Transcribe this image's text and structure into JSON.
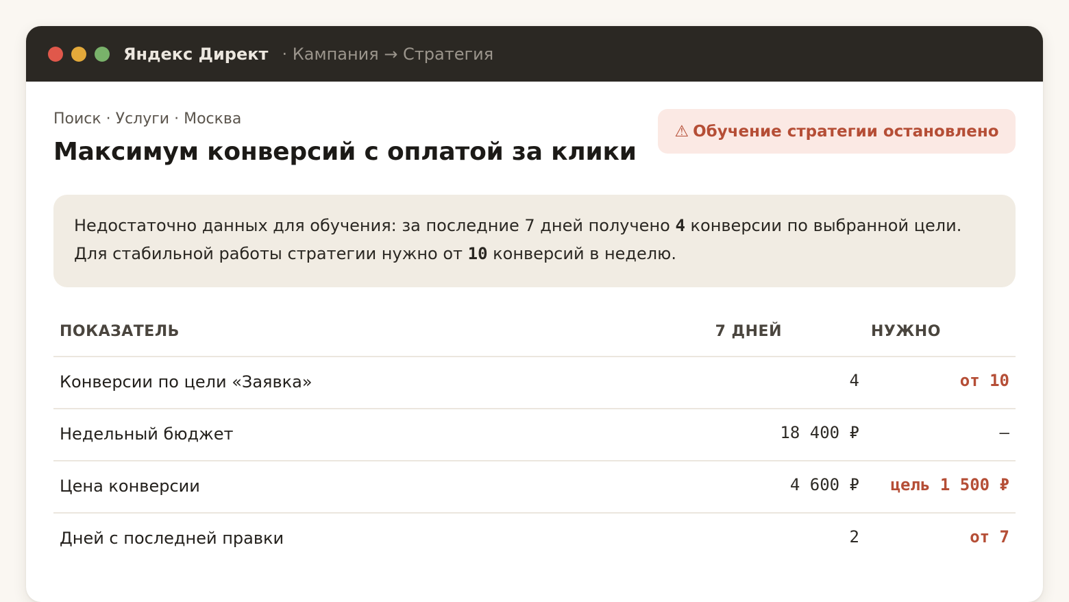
{
  "titlebar": {
    "app_title": "Яндекс Директ",
    "crumbs": "· Кампания → Стратегия"
  },
  "header": {
    "subtitle": "Поиск · Услуги · Москва",
    "title": "Максимум конверсий с оплатой за клики",
    "badge_icon": "⚠",
    "badge_text": "Обучение стратегии остановлено"
  },
  "notice": {
    "line1_prefix": "Недостаточно данных для обучения: за последние 7 дней получено ",
    "line1_value": "4",
    "line1_suffix": " конверсии по выбранной цели.",
    "line2_prefix": "Для стабильной работы стратегии нужно от ",
    "line2_value": "10",
    "line2_suffix": " конверсий в неделю."
  },
  "table": {
    "headers": {
      "metric": "ПОКАЗАТЕЛЬ",
      "days": "7 ДНЕЙ",
      "need": "НУЖНО"
    },
    "rows": [
      {
        "label": "Конверсии по цели «Заявка»",
        "value": "4",
        "need": "от 10"
      },
      {
        "label": "Недельный бюджет",
        "value": "18 400 ₽",
        "need": "—"
      },
      {
        "label": "Цена конверсии",
        "value": "4 600 ₽",
        "need": "цель 1 500 ₽"
      },
      {
        "label": "Дней с последней правки",
        "value": "2",
        "need": "от 7"
      }
    ]
  },
  "colors": {
    "titlebar_bg": "#2b2823",
    "accent_red": "#b54e36",
    "badge_bg": "#fbe9e4",
    "notice_bg": "#f1ece3"
  }
}
